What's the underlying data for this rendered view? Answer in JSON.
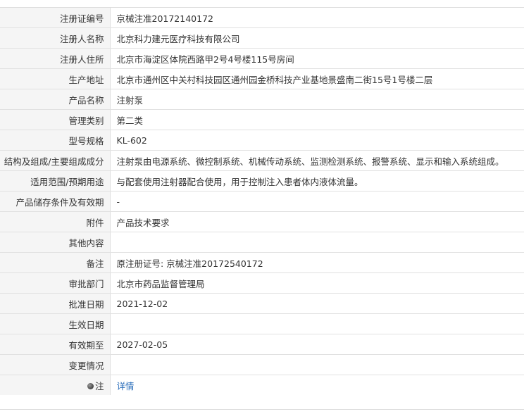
{
  "rows": [
    {
      "label": "注册证编号",
      "value": "京械注准20172140172"
    },
    {
      "label": "注册人名称",
      "value": "北京科力建元医疗科技有限公司"
    },
    {
      "label": "注册人住所",
      "value": "北京市海淀区体院西路甲2号4号楼115号房间"
    },
    {
      "label": "生产地址",
      "value": "北京市通州区中关村科技园区通州园金桥科技产业基地景盛南二街15号1号楼二层"
    },
    {
      "label": "产品名称",
      "value": "注射泵"
    },
    {
      "label": "管理类别",
      "value": "第二类"
    },
    {
      "label": "型号规格",
      "value": "KL-602"
    },
    {
      "label": "结构及组成/主要组成成分",
      "value": "注射泵由电源系统、微控制系统、机械传动系统、监测检测系统、报警系统、显示和输入系统组成。"
    },
    {
      "label": "适用范围/预期用途",
      "value": "与配套使用注射器配合使用，用于控制注入患者体内液体流量。"
    },
    {
      "label": "产品储存条件及有效期",
      "value": "-"
    },
    {
      "label": "附件",
      "value": "产品技术要求"
    },
    {
      "label": "其他内容",
      "value": ""
    },
    {
      "label": "备注",
      "value": "原注册证号: 京械注准20172540172"
    },
    {
      "label": "审批部门",
      "value": "北京市药品监督管理局"
    },
    {
      "label": "批准日期",
      "value": "2021-12-02"
    },
    {
      "label": "生效日期",
      "value": ""
    },
    {
      "label": "有效期至",
      "value": "2027-02-05"
    },
    {
      "label": "变更情况",
      "value": ""
    }
  ],
  "note_row": {
    "label": "注",
    "icon": "note-bullet-icon",
    "link": "详情"
  }
}
